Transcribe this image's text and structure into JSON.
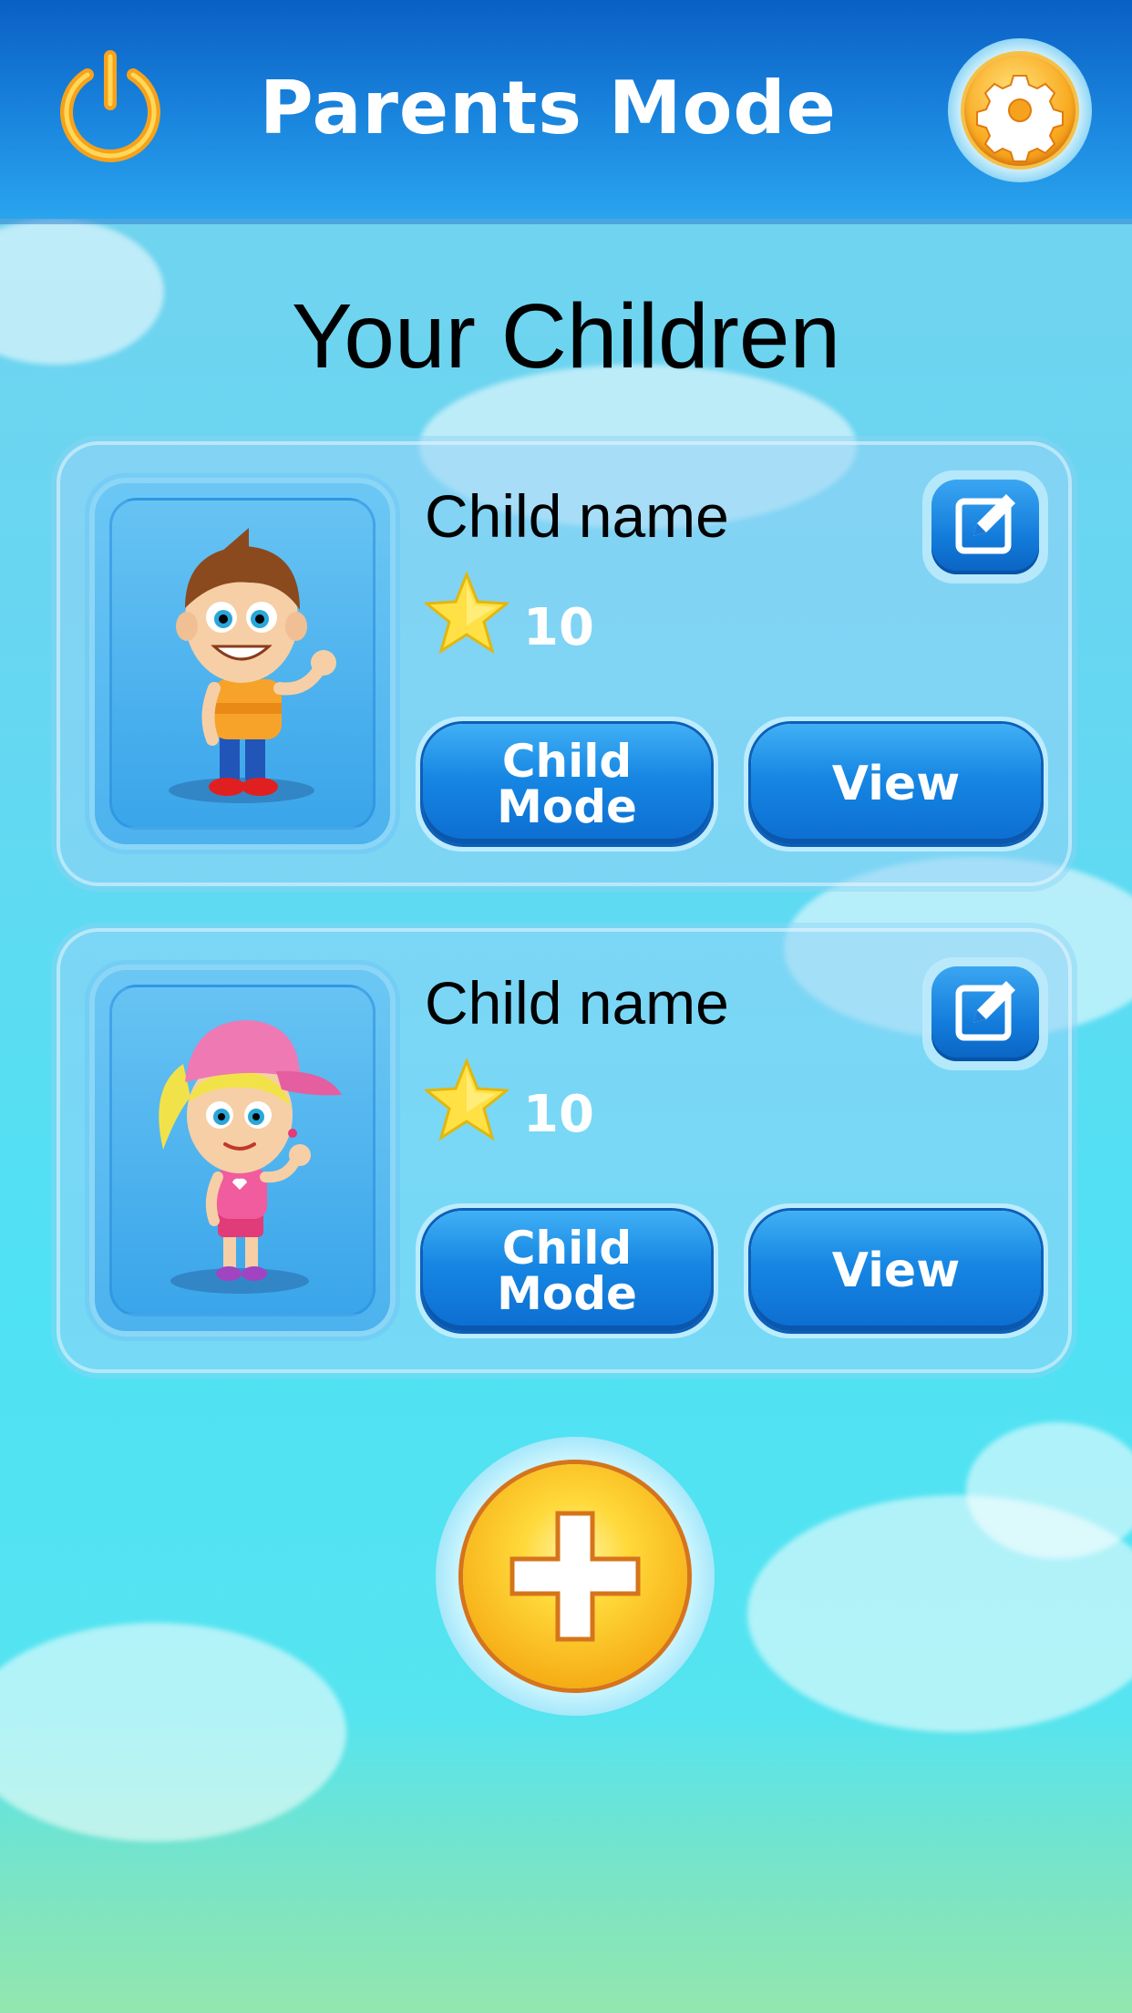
{
  "header": {
    "title": "Parents Mode",
    "power_icon": "power-icon",
    "settings_icon": "gear-icon"
  },
  "page_title": "Your Children",
  "children": [
    {
      "name": "Child name",
      "stars": "10",
      "avatar": "boy-avatar",
      "child_mode_label_line1": "Child",
      "child_mode_label_line2": "Mode",
      "view_label": "View",
      "edit_icon": "edit-icon"
    },
    {
      "name": "Child name",
      "stars": "10",
      "avatar": "girl-avatar",
      "child_mode_label_line1": "Child",
      "child_mode_label_line2": "Mode",
      "view_label": "View",
      "edit_icon": "edit-icon"
    }
  ],
  "add_button_icon": "plus-icon",
  "colors": {
    "header": "#1a86de",
    "button_blue": "#1686e3",
    "accent_orange": "#f9a920",
    "star_yellow": "#ffe045"
  }
}
